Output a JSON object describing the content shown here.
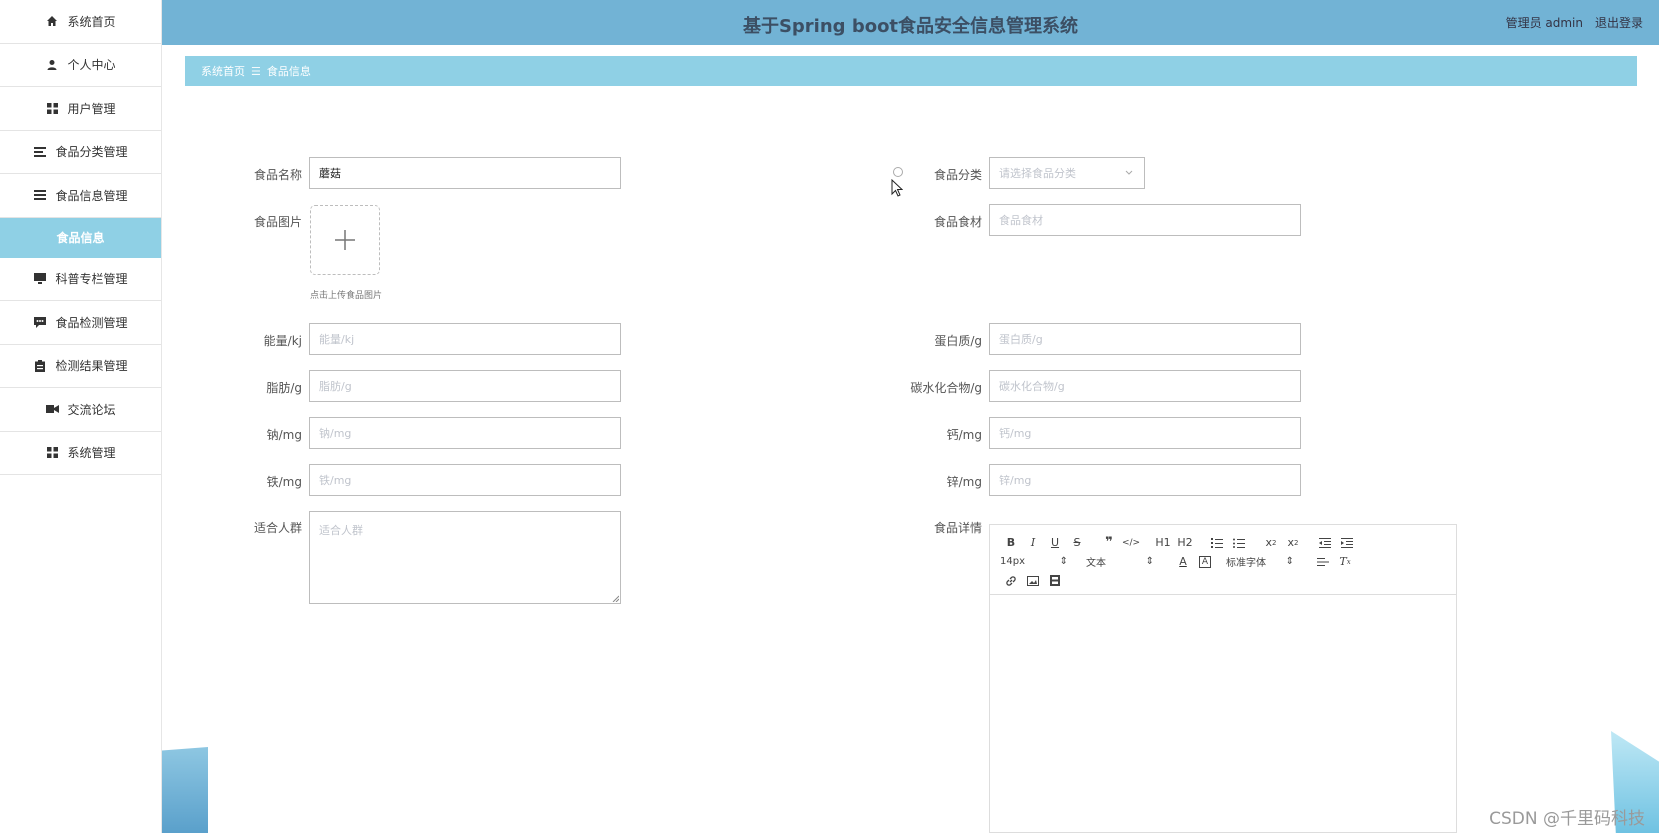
{
  "header": {
    "title": "基于Spring boot食品安全信息管理系统",
    "user": "管理员 admin",
    "logout": "退出登录"
  },
  "sidebar": {
    "items": [
      {
        "label": "系统首页",
        "icon": "home-icon"
      },
      {
        "label": "个人中心",
        "icon": "user-icon"
      },
      {
        "label": "用户管理",
        "icon": "grid-icon"
      },
      {
        "label": "食品分类管理",
        "icon": "list-icon"
      },
      {
        "label": "食品信息管理",
        "icon": "list-icon"
      },
      {
        "label": "食品信息",
        "icon": "",
        "active": true
      },
      {
        "label": "科普专栏管理",
        "icon": "monitor-icon"
      },
      {
        "label": "食品检测管理",
        "icon": "chat-icon"
      },
      {
        "label": "检测结果管理",
        "icon": "clipboard-icon"
      },
      {
        "label": "交流论坛",
        "icon": "video-icon"
      },
      {
        "label": "系统管理",
        "icon": "grid-icon"
      }
    ]
  },
  "breadcrumb": {
    "home": "系统首页",
    "separator": "☰",
    "current": "食品信息"
  },
  "form": {
    "name": {
      "label": "食品名称",
      "value": "蘑菇"
    },
    "category": {
      "label": "食品分类",
      "placeholder": "请选择食品分类"
    },
    "image": {
      "label": "食品图片",
      "hint": "点击上传食品图片"
    },
    "ingredients": {
      "label": "食品食材",
      "placeholder": "食品食材"
    },
    "energy": {
      "label": "能量/kj",
      "placeholder": "能量/kj"
    },
    "protein": {
      "label": "蛋白质/g",
      "placeholder": "蛋白质/g"
    },
    "fat": {
      "label": "脂肪/g",
      "placeholder": "脂肪/g"
    },
    "carbs": {
      "label": "碳水化合物/g",
      "placeholder": "碳水化合物/g"
    },
    "sodium": {
      "label": "钠/mg",
      "placeholder": "钠/mg"
    },
    "calcium": {
      "label": "钙/mg",
      "placeholder": "钙/mg"
    },
    "iron": {
      "label": "铁/mg",
      "placeholder": "铁/mg"
    },
    "zinc": {
      "label": "锌/mg",
      "placeholder": "锌/mg"
    },
    "audience": {
      "label": "适合人群",
      "placeholder": "适合人群"
    },
    "details": {
      "label": "食品详情"
    }
  },
  "editor": {
    "font_size": "14px",
    "text_style": "文本",
    "font_family": "标准字体",
    "h1": "H1",
    "h2": "H2"
  },
  "watermark": "CSDN @千里码科技",
  "colors": {
    "header": "#72b3d5",
    "accent": "#8fd0e5",
    "title": "#3c4f64"
  }
}
